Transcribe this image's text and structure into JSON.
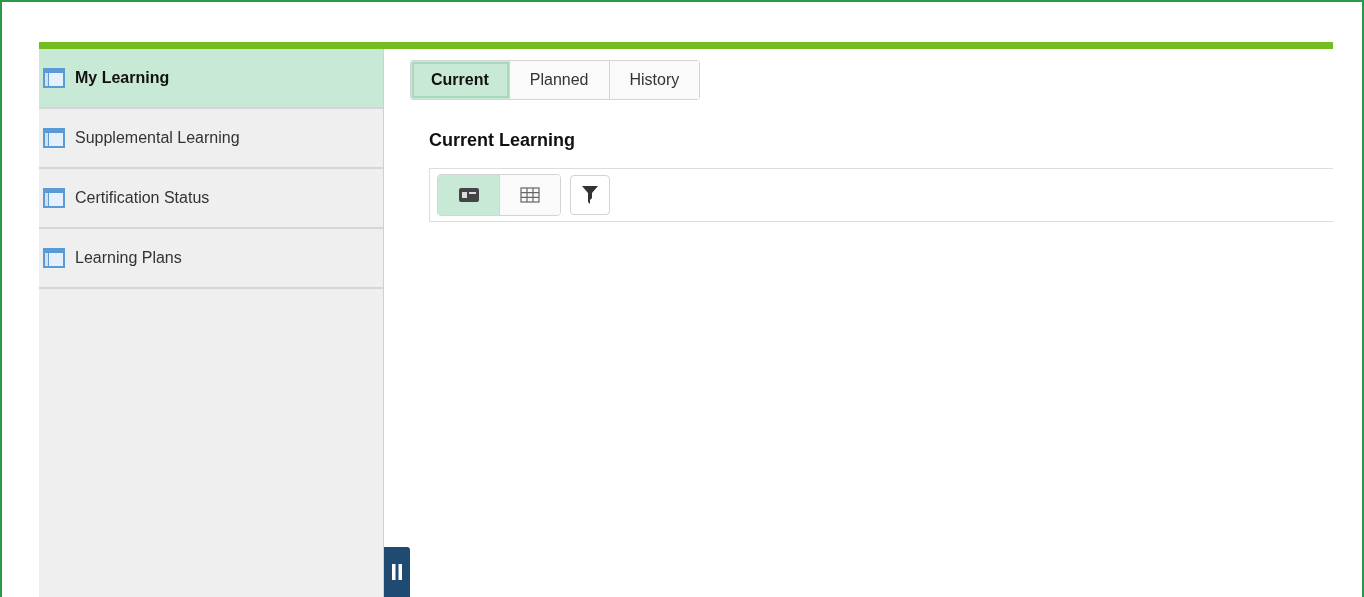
{
  "sidebar": {
    "items": [
      {
        "label": "My Learning",
        "selected": true
      },
      {
        "label": "Supplemental Learning",
        "selected": false
      },
      {
        "label": "Certification Status",
        "selected": false
      },
      {
        "label": "Learning Plans",
        "selected": false
      }
    ]
  },
  "tabs": [
    {
      "label": "Current",
      "selected": true
    },
    {
      "label": "Planned",
      "selected": false
    },
    {
      "label": "History",
      "selected": false
    }
  ],
  "section_title": "Current Learning",
  "view_toggle": [
    {
      "kind": "card",
      "selected": true
    },
    {
      "kind": "grid",
      "selected": false
    }
  ]
}
